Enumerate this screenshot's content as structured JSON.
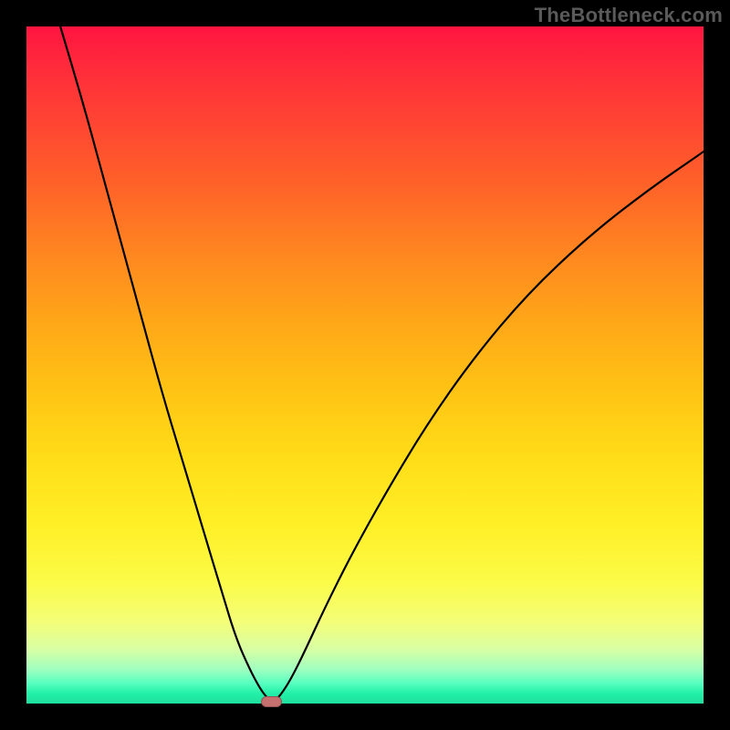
{
  "watermark": "TheBottleneck.com",
  "chart_data": {
    "type": "line",
    "title": "",
    "xlabel": "",
    "ylabel": "",
    "xlim": [
      0,
      100
    ],
    "ylim": [
      0,
      100
    ],
    "grid": false,
    "series": [
      {
        "name": "bottleneck-curve",
        "x": [
          5,
          8,
          11,
          14,
          17,
          20,
          23,
          26,
          29,
          31,
          33,
          34.5,
          35.5,
          36,
          36.3,
          36.6,
          37.5,
          39,
          41,
          44,
          48,
          53,
          59,
          66,
          74,
          83,
          92,
          100
        ],
        "y": [
          100,
          90,
          79,
          68,
          57,
          46,
          36,
          26,
          16,
          9.5,
          5,
          2.2,
          0.9,
          0.4,
          0.25,
          0.4,
          1.2,
          3.5,
          7.5,
          14,
          22,
          31,
          41,
          51,
          60.5,
          69,
          76,
          81.5
        ]
      }
    ],
    "annotations": [
      {
        "name": "optimum-marker",
        "x": 36.2,
        "y": 0.25,
        "w": 3.2,
        "h": 1.6,
        "color": "#c77070"
      }
    ],
    "background": {
      "type": "vertical-gradient",
      "stops": [
        {
          "pos": 0.0,
          "color": "#ff1440"
        },
        {
          "pos": 0.5,
          "color": "#ffc414"
        },
        {
          "pos": 0.82,
          "color": "#fbfb48"
        },
        {
          "pos": 1.0,
          "color": "#1fe09f"
        }
      ]
    }
  }
}
